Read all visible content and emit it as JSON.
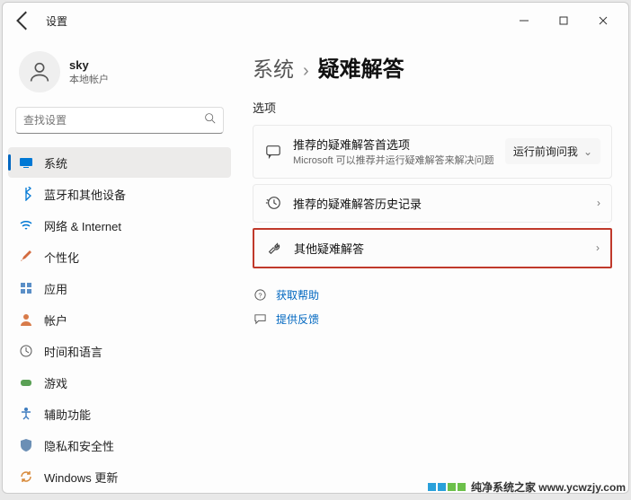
{
  "window": {
    "title": "设置"
  },
  "user": {
    "name": "sky",
    "account_type": "本地帐户"
  },
  "search": {
    "placeholder": "查找设置"
  },
  "sidebar": {
    "items": [
      {
        "label": "系统"
      },
      {
        "label": "蓝牙和其他设备"
      },
      {
        "label": "网络 & Internet"
      },
      {
        "label": "个性化"
      },
      {
        "label": "应用"
      },
      {
        "label": "帐户"
      },
      {
        "label": "时间和语言"
      },
      {
        "label": "游戏"
      },
      {
        "label": "辅助功能"
      },
      {
        "label": "隐私和安全性"
      },
      {
        "label": "Windows 更新"
      }
    ],
    "active_index": 0
  },
  "breadcrumb": {
    "parent": "系统",
    "current": "疑难解答"
  },
  "section_label": "选项",
  "cards": [
    {
      "title": "推荐的疑难解答首选项",
      "subtitle": "Microsoft 可以推荐并运行疑难解答来解决问题",
      "action_label": "运行前询问我",
      "has_dropdown": true
    },
    {
      "title": "推荐的疑难解答历史记录",
      "has_chevron": true
    },
    {
      "title": "其他疑难解答",
      "has_chevron": true,
      "highlighted": true
    }
  ],
  "links": {
    "help": "获取帮助",
    "feedback": "提供反馈"
  },
  "watermark": "纯净系统之家 www.ycwzjy.com"
}
